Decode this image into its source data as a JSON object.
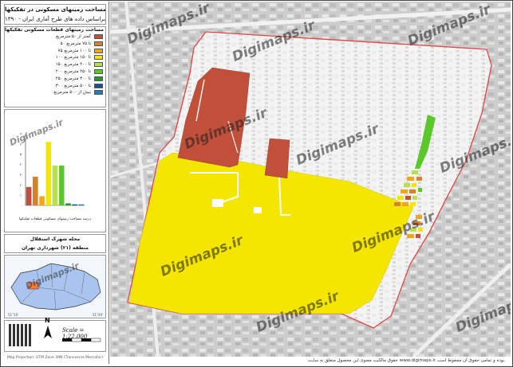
{
  "title": {
    "line1": "مساحت زمینهای مسکونی در تفکیکها",
    "line2": "براساس داده های طرح آماری ایران - ۱۳۹۰"
  },
  "legend": {
    "heading": "مساحت زمینهای قطعات مسکونی تفکیکها",
    "items": [
      {
        "label": "کمتر از ۵۰ مترمربع",
        "color": "#c0503a"
      },
      {
        "label": "۵۰ تا ۷۵ مترمربع",
        "color": "#d9822b"
      },
      {
        "label": "۷۵ تا ۱۰۰ مترمربع",
        "color": "#f0a61c"
      },
      {
        "label": "۱۰۰ تا ۱۵۰ مترمربع",
        "color": "#f5e600"
      },
      {
        "label": "۱۵۰ تا ۲۰۰ مترمربع",
        "color": "#b7e04a"
      },
      {
        "label": "۲۰۰ تا ۲۵۰ مترمربع",
        "color": "#5bc82a"
      },
      {
        "label": "۲۵۰ تا ۳۰۰ مترمربع",
        "color": "#1f9a2b"
      },
      {
        "label": "۳۰۰ تا ۵۰۰ مترمربع",
        "color": "#1c4f8f"
      },
      {
        "label": "بیش از ۵۰۰ مترمربع",
        "color": "#1f7fb5"
      }
    ]
  },
  "chart_data": {
    "type": "bar",
    "categories": [
      "<50",
      "50-75",
      "75-100",
      "100-150",
      "150-200",
      "200-250",
      "250-300",
      "300-500",
      ">500"
    ],
    "values": [
      18,
      28,
      9,
      62,
      39,
      39,
      2,
      1,
      1
    ],
    "ylim": [
      0,
      70
    ],
    "yticks": [
      "۰",
      "۱۰",
      "۲۰",
      "۳۰",
      "۴۰",
      "۵۰",
      "۶۰",
      "۷۰"
    ],
    "colors": [
      "#c0503a",
      "#d9822b",
      "#f0a61c",
      "#f5e600",
      "#b7e04a",
      "#5bc82a",
      "#1f9a2b",
      "#1c4f8f",
      "#1f7fb5"
    ],
    "caption": "درصد مساحت زمینهای مسکونی قطعات تفکیکها"
  },
  "locality": {
    "name": "محله شهرک استقلال",
    "district": "منطقه (۲۱) شهرداری تهران"
  },
  "scale": "Scale = 1:22,000",
  "north": "N",
  "footer_left": "Map Projection: UTM Zone 39N (Transverse Mercator)",
  "copyright": "حقوق مالکیت معنوی این محصول متعلق به سایت www.digimaps.ir بوده و تمامی حقوق آن محفوظ است.",
  "watermark": "Digimaps.ir"
}
